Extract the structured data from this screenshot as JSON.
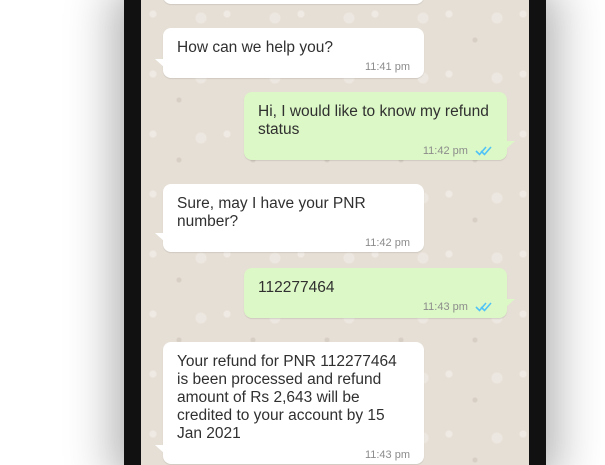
{
  "chat": {
    "messages": [
      {
        "direction": "in",
        "text": "How can we help you?",
        "time": "11:41 pm"
      },
      {
        "direction": "out",
        "text": "Hi, I would like to know my refund status",
        "time": "11:42 pm",
        "status": "read"
      },
      {
        "direction": "in",
        "text": "Sure, may I have your PNR number?",
        "time": "11:42 pm"
      },
      {
        "direction": "out",
        "text": "112277464",
        "time": "11:43 pm",
        "status": "read"
      },
      {
        "direction": "in",
        "text": "Your refund for PNR 112277464 is been processed and refund amount of Rs 2,643 will be credited to your account by 15 Jan 2021",
        "time": "11:43 pm"
      }
    ]
  },
  "colors": {
    "incoming_bubble": "#ffffff",
    "outgoing_bubble": "#dcf8c6",
    "chat_background": "#e6dfd6",
    "read_tick": "#4fc3f7",
    "timestamp": "#8c8c8c"
  },
  "icons": {
    "read_receipt": "double-check-icon"
  }
}
